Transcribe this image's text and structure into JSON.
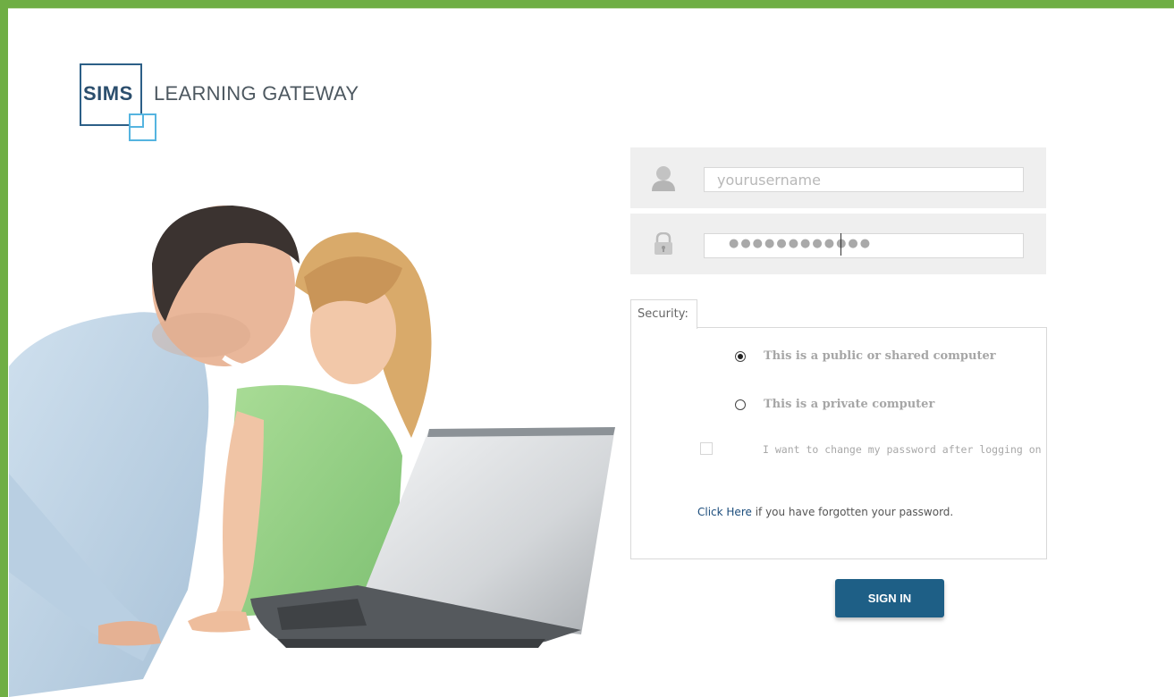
{
  "brand": {
    "logo_short": "SIMS",
    "logo_name": "LEARNING GATEWAY",
    "frame_color": "#6fae44",
    "logo_dark": "#2c5f87",
    "logo_light": "#55b4e0"
  },
  "login": {
    "username_placeholder": "yourusername",
    "password_masked": "●●●●●●●●●●●●",
    "user_icon": "user-silhouette-icon",
    "lock_icon": "padlock-icon"
  },
  "security": {
    "label": "Security:",
    "options": [
      {
        "label": "This is a public or shared computer",
        "selected": true
      },
      {
        "label": "This is a private computer",
        "selected": false
      }
    ],
    "change_password_label": "I want to change my password after logging on",
    "change_password_checked": false,
    "forgot_link": "Click Here",
    "forgot_text": " if you have forgotten your password."
  },
  "actions": {
    "sign_in_label": "SIGN IN",
    "sign_in_color": "#1e5f86"
  }
}
